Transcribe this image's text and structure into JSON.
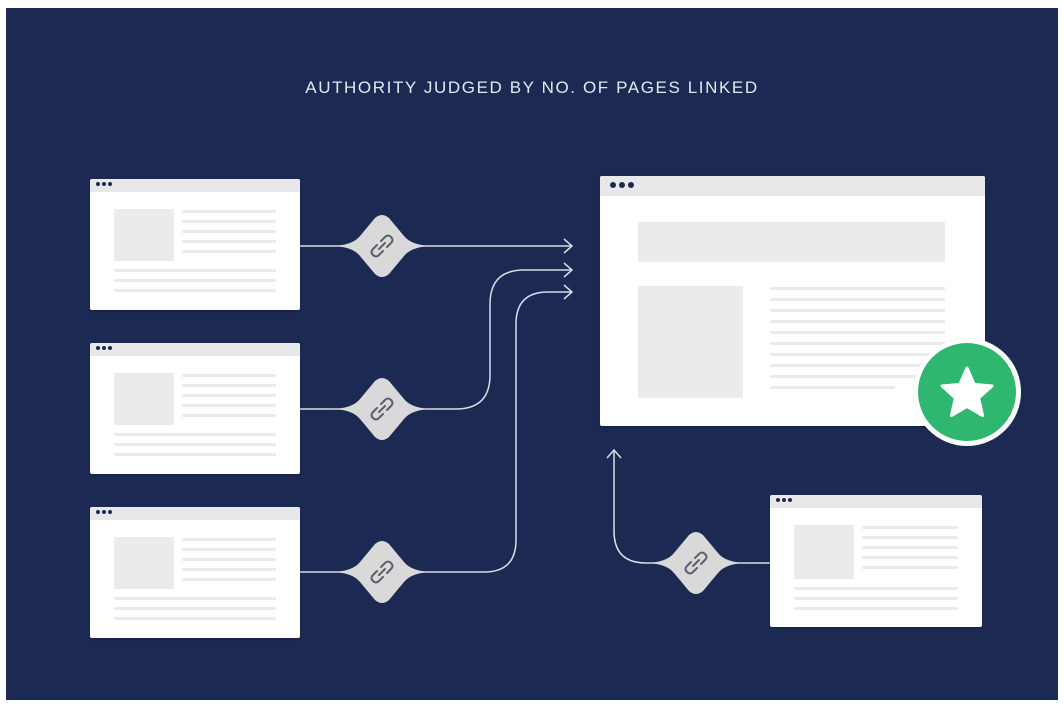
{
  "title": "AUTHORITY JUDGED BY NO. OF PAGES LINKED",
  "colors": {
    "background": "#1c2a53",
    "page": "#ffffff",
    "placeholder": "#ebebeb",
    "link_badge": "#d9d9d9",
    "authority_badge": "#2fb66f"
  },
  "nodes": [
    {
      "name": "linking-page-1",
      "icon": "browser-window"
    },
    {
      "name": "linking-page-2",
      "icon": "browser-window"
    },
    {
      "name": "linking-page-3",
      "icon": "browser-window"
    },
    {
      "name": "linking-page-4",
      "icon": "browser-window"
    },
    {
      "name": "target-page",
      "icon": "browser-window",
      "badge_icon": "star-icon"
    }
  ],
  "edges": [
    {
      "from": "linking-page-1",
      "to": "target-page",
      "icon": "link-icon"
    },
    {
      "from": "linking-page-2",
      "to": "target-page",
      "icon": "link-icon"
    },
    {
      "from": "linking-page-3",
      "to": "target-page",
      "icon": "link-icon"
    },
    {
      "from": "linking-page-4",
      "to": "target-page",
      "icon": "link-icon"
    }
  ]
}
